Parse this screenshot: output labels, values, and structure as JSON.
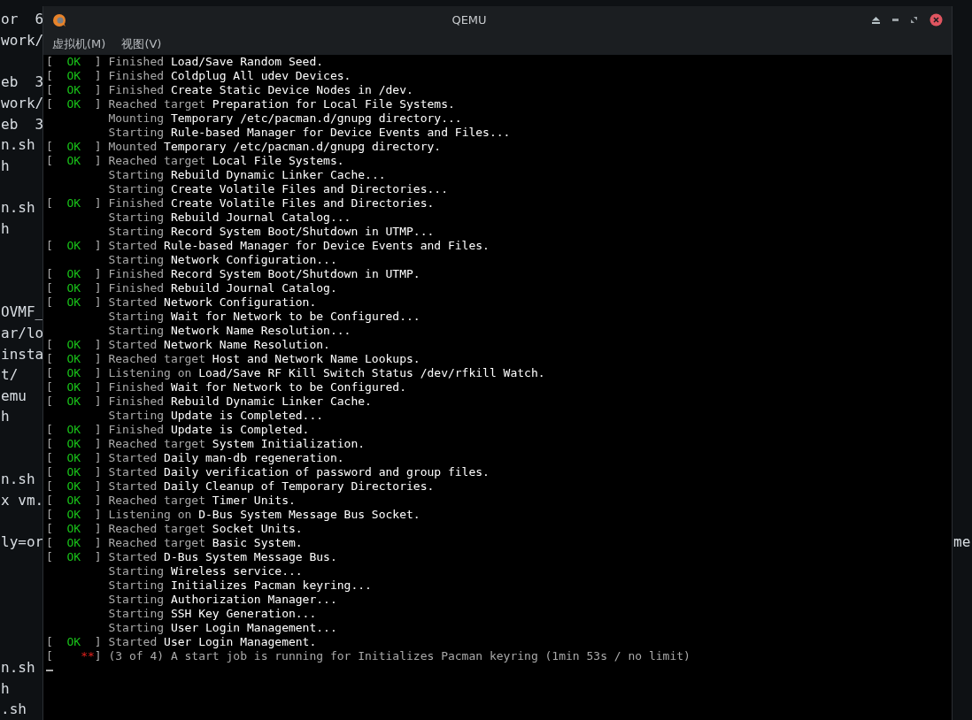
{
  "background_terminal": {
    "rows": [
      {
        "left": "or  6"
      },
      {
        "left": "work/"
      },
      {},
      {
        "left": "eb  3"
      },
      {
        "left": "work/"
      },
      {
        "left": "eb  3"
      },
      {
        "left": "n.sh"
      },
      {
        "left": "h"
      },
      {},
      {
        "left": "n.sh"
      },
      {
        "left": "h"
      },
      {},
      {},
      {},
      {
        "left": "OVMF_"
      },
      {
        "left": "ar/lo"
      },
      {
        "left": "insta"
      },
      {
        "left": "t/"
      },
      {
        "left": "emu"
      },
      {
        "left": "h"
      },
      {},
      {},
      {
        "left": "n.sh"
      },
      {
        "left": "x vm."
      },
      {},
      {
        "left": "ly=or",
        "right": "me"
      },
      {},
      {},
      {},
      {},
      {},
      {
        "left": "n.sh"
      },
      {
        "left": "h"
      },
      {
        "left": ".sh"
      }
    ]
  },
  "window": {
    "title": "QEMU",
    "menu": [
      "虚拟机(M)",
      "视图(V)"
    ],
    "console": [
      {
        "kind": "ok",
        "tag": [
          "[",
          "OK",
          "]"
        ],
        "verb": "Finished",
        "text": "Load/Save Random Seed."
      },
      {
        "kind": "ok",
        "tag": [
          "[",
          "OK",
          "]"
        ],
        "verb": "Finished",
        "text": "Coldplug All udev Devices."
      },
      {
        "kind": "ok",
        "tag": [
          "[",
          "OK",
          "]"
        ],
        "verb": "Finished",
        "text": "Create Static Device Nodes in /dev."
      },
      {
        "kind": "ok",
        "tag": [
          "[",
          "OK",
          "]"
        ],
        "verb": "Reached target",
        "text": "Preparation for Local File Systems."
      },
      {
        "kind": "plain",
        "verb": "Mounting",
        "text": "Temporary /etc/pacman.d/gnupg directory..."
      },
      {
        "kind": "plain",
        "verb": "Starting",
        "text": "Rule-based Manager for Device Events and Files..."
      },
      {
        "kind": "ok",
        "tag": [
          "[",
          "OK",
          "]"
        ],
        "verb": "Mounted",
        "text": "Temporary /etc/pacman.d/gnupg directory."
      },
      {
        "kind": "ok",
        "tag": [
          "[",
          "OK",
          "]"
        ],
        "verb": "Reached target",
        "text": "Local File Systems."
      },
      {
        "kind": "plain",
        "verb": "Starting",
        "text": "Rebuild Dynamic Linker Cache..."
      },
      {
        "kind": "plain",
        "verb": "Starting",
        "text": "Create Volatile Files and Directories..."
      },
      {
        "kind": "ok",
        "tag": [
          "[",
          "OK",
          "]"
        ],
        "verb": "Finished",
        "text": "Create Volatile Files and Directories."
      },
      {
        "kind": "plain",
        "verb": "Starting",
        "text": "Rebuild Journal Catalog..."
      },
      {
        "kind": "plain",
        "verb": "Starting",
        "text": "Record System Boot/Shutdown in UTMP..."
      },
      {
        "kind": "ok",
        "tag": [
          "[",
          "OK",
          "]"
        ],
        "verb": "Started",
        "text": "Rule-based Manager for Device Events and Files."
      },
      {
        "kind": "plain",
        "verb": "Starting",
        "text": "Network Configuration..."
      },
      {
        "kind": "ok",
        "tag": [
          "[",
          "OK",
          "]"
        ],
        "verb": "Finished",
        "text": "Record System Boot/Shutdown in UTMP."
      },
      {
        "kind": "ok",
        "tag": [
          "[",
          "OK",
          "]"
        ],
        "verb": "Finished",
        "text": "Rebuild Journal Catalog."
      },
      {
        "kind": "ok",
        "tag": [
          "[",
          "OK",
          "]"
        ],
        "verb": "Started",
        "text": "Network Configuration."
      },
      {
        "kind": "plain",
        "verb": "Starting",
        "text": "Wait for Network to be Configured..."
      },
      {
        "kind": "plain",
        "verb": "Starting",
        "text": "Network Name Resolution..."
      },
      {
        "kind": "ok",
        "tag": [
          "[",
          "OK",
          "]"
        ],
        "verb": "Started",
        "text": "Network Name Resolution."
      },
      {
        "kind": "ok",
        "tag": [
          "[",
          "OK",
          "]"
        ],
        "verb": "Reached target",
        "text": "Host and Network Name Lookups."
      },
      {
        "kind": "ok",
        "tag": [
          "[",
          "OK",
          "]"
        ],
        "verb": "Listening on",
        "text": "Load/Save RF Kill Switch Status /dev/rfkill Watch."
      },
      {
        "kind": "ok",
        "tag": [
          "[",
          "OK",
          "]"
        ],
        "verb": "Finished",
        "text": "Wait for Network to be Configured."
      },
      {
        "kind": "ok",
        "tag": [
          "[",
          "OK",
          "]"
        ],
        "verb": "Finished",
        "text": "Rebuild Dynamic Linker Cache."
      },
      {
        "kind": "plain",
        "verb": "Starting",
        "text": "Update is Completed..."
      },
      {
        "kind": "ok",
        "tag": [
          "[",
          "OK",
          "]"
        ],
        "verb": "Finished",
        "text": "Update is Completed."
      },
      {
        "kind": "ok",
        "tag": [
          "[",
          "OK",
          "]"
        ],
        "verb": "Reached target",
        "text": "System Initialization."
      },
      {
        "kind": "ok",
        "tag": [
          "[",
          "OK",
          "]"
        ],
        "verb": "Started",
        "text": "Daily man-db regeneration."
      },
      {
        "kind": "ok",
        "tag": [
          "[",
          "OK",
          "]"
        ],
        "verb": "Started",
        "text": "Daily verification of password and group files."
      },
      {
        "kind": "ok",
        "tag": [
          "[",
          "OK",
          "]"
        ],
        "verb": "Started",
        "text": "Daily Cleanup of Temporary Directories."
      },
      {
        "kind": "ok",
        "tag": [
          "[",
          "OK",
          "]"
        ],
        "verb": "Reached target",
        "text": "Timer Units."
      },
      {
        "kind": "ok",
        "tag": [
          "[",
          "OK",
          "]"
        ],
        "verb": "Listening on",
        "text": "D-Bus System Message Bus Socket."
      },
      {
        "kind": "ok",
        "tag": [
          "[",
          "OK",
          "]"
        ],
        "verb": "Reached target",
        "text": "Socket Units."
      },
      {
        "kind": "ok",
        "tag": [
          "[",
          "OK",
          "]"
        ],
        "verb": "Reached target",
        "text": "Basic System."
      },
      {
        "kind": "ok",
        "tag": [
          "[",
          "OK",
          "]"
        ],
        "verb": "Started",
        "text": "D-Bus System Message Bus."
      },
      {
        "kind": "plain",
        "verb": "Starting",
        "text": "Wireless service..."
      },
      {
        "kind": "plain",
        "verb": "Starting",
        "text": "Initializes Pacman keyring..."
      },
      {
        "kind": "plain",
        "verb": "Starting",
        "text": "Authorization Manager..."
      },
      {
        "kind": "plain",
        "verb": "Starting",
        "text": "SSH Key Generation..."
      },
      {
        "kind": "plain",
        "verb": "Starting",
        "text": "User Login Management..."
      },
      {
        "kind": "ok",
        "tag": [
          "[",
          "OK",
          "]"
        ],
        "verb": "Started",
        "text": "User Login Management."
      },
      {
        "kind": "progress",
        "tag": [
          "[",
          "**",
          "]"
        ],
        "text": "(3 of 4) A start job is running for Initializes Pacman keyring (1min 53s / no limit)"
      }
    ]
  }
}
